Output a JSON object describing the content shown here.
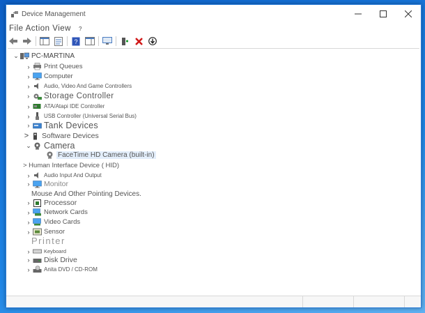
{
  "window": {
    "title": "Device Management"
  },
  "menu": {
    "file_action_view": "File Action View",
    "help": "?"
  },
  "tree": {
    "root": "PC-MARTINA",
    "items": [
      {
        "label": "Print Queues"
      },
      {
        "label": "Computer"
      },
      {
        "label": "Audio, Video And Game Controllers"
      },
      {
        "label": "Storage Controller"
      },
      {
        "label": "ATA/Atapi IDE Controller"
      },
      {
        "label": "USB Controller (Universal Serial Bus)"
      },
      {
        "label": "Tank Devices"
      },
      {
        "label": "Software Devices"
      },
      {
        "label": "Camera"
      },
      {
        "label": "FaceTime HD Camera (built-in)"
      },
      {
        "label": "> Human Interface Device ( HID)"
      },
      {
        "label": "Audio Input And Output"
      },
      {
        "label": "Monitor"
      },
      {
        "label": "Mouse And Other Pointing Devices."
      },
      {
        "label": "Processor"
      },
      {
        "label": "Network Cards"
      },
      {
        "label": "Video Cards"
      },
      {
        "label": "Sensor"
      },
      {
        "label": "Printer"
      },
      {
        "label": "Keyboard"
      },
      {
        "label": "Disk Drive"
      },
      {
        "label": "Anita DVD / CD-ROM"
      }
    ]
  }
}
